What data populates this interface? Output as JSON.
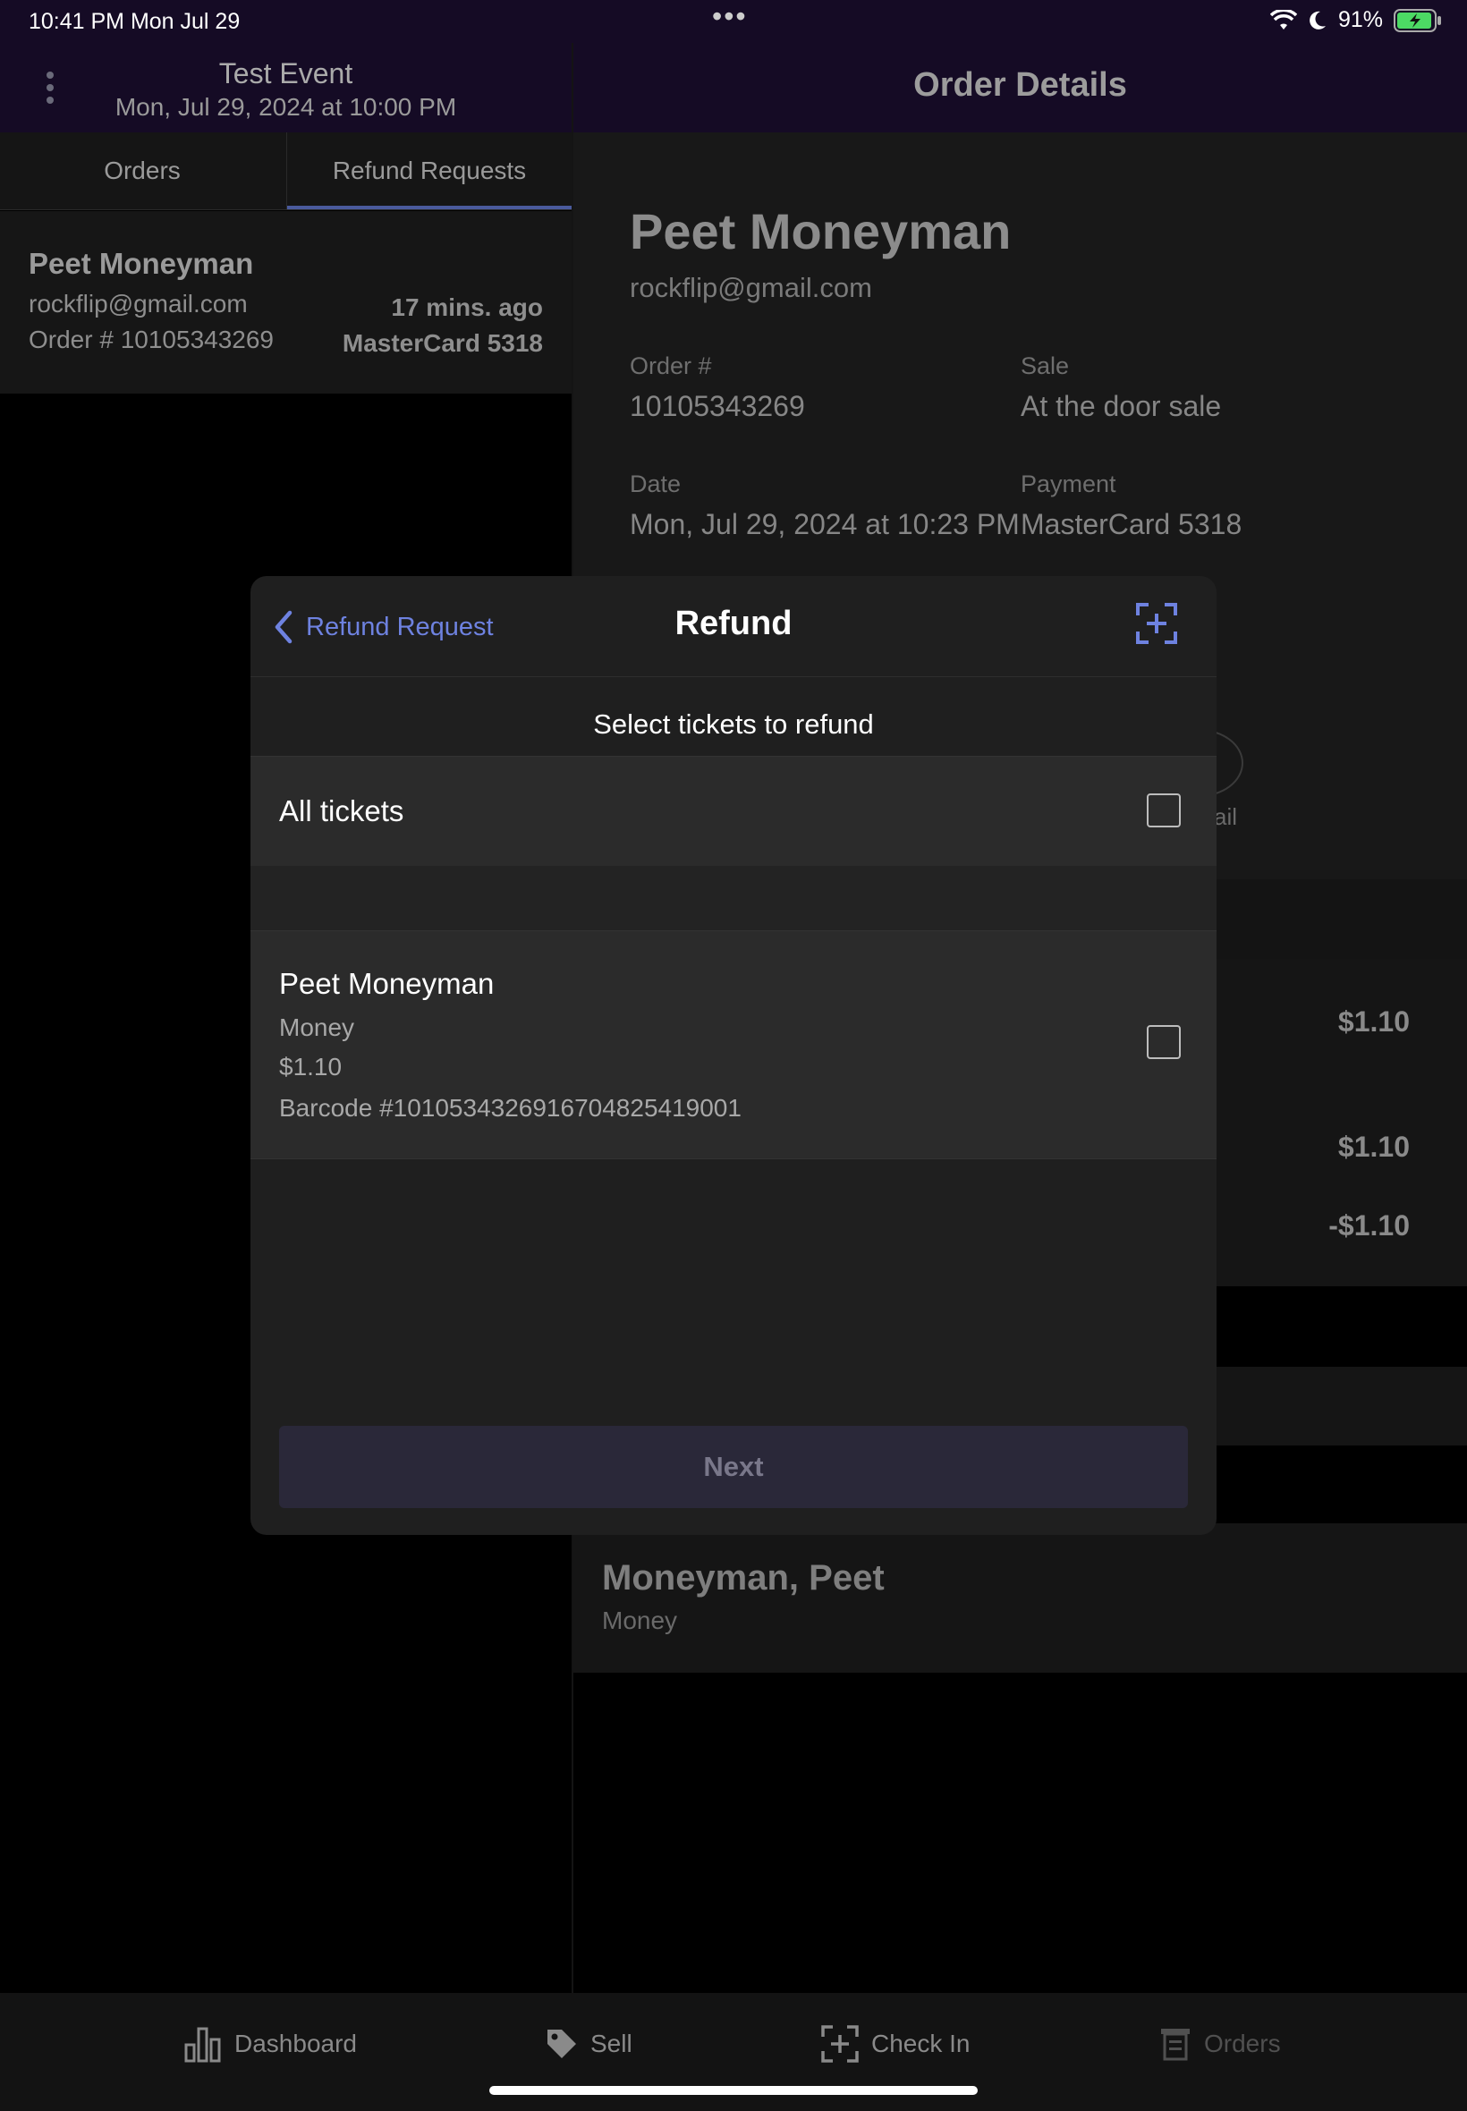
{
  "status_bar": {
    "time": "10:41 PM   Mon Jul 29",
    "battery": "91%"
  },
  "event": {
    "name": "Test Event",
    "date": "Mon, Jul 29, 2024 at 10:00 PM"
  },
  "left_tabs": [
    {
      "label": "Orders"
    },
    {
      "label": "Refund Requests"
    }
  ],
  "refund_list": [
    {
      "name": "Peet Moneyman",
      "email": "rockflip@gmail.com",
      "order": "Order # 10105343269",
      "time_ago": "17 mins. ago",
      "payment": "MasterCard 5318"
    }
  ],
  "order_details": {
    "title": "Order Details",
    "customer_name": "Peet Moneyman",
    "customer_email": "rockflip@gmail.com",
    "order_label": "Order #",
    "order_value": "10105343269",
    "sale_label": "Sale",
    "sale_value": "At the door sale",
    "date_label": "Date",
    "date_value": "Mon, Jul 29, 2024 at 10:23 PM",
    "payment_label": "Payment",
    "payment_value": "MasterCard 5318",
    "partial_email_label": "ail",
    "amounts": [
      "$1.10",
      "$1.10",
      "-$1.10"
    ],
    "attendee_name": "Moneyman, Peet",
    "attendee_type": "Money"
  },
  "modal": {
    "back_label": "Refund Request",
    "title": "Refund",
    "subtitle": "Select tickets to refund",
    "all_tickets_label": "All tickets",
    "ticket": {
      "name": "Peet Moneyman",
      "type": "Money",
      "price": "$1.10",
      "barcode": "Barcode #1010534326916704825419001"
    },
    "next_label": "Next"
  },
  "tabbar": [
    {
      "label": "Dashboard",
      "icon": "bar-chart-icon"
    },
    {
      "label": "Sell",
      "icon": "tag-icon"
    },
    {
      "label": "Check In",
      "icon": "scan-icon"
    },
    {
      "label": "Orders",
      "icon": "orders-icon"
    }
  ],
  "colors": {
    "accent": "#6e82e0",
    "header_bg": "#150b25",
    "modal_bg": "#1f1f1f"
  }
}
